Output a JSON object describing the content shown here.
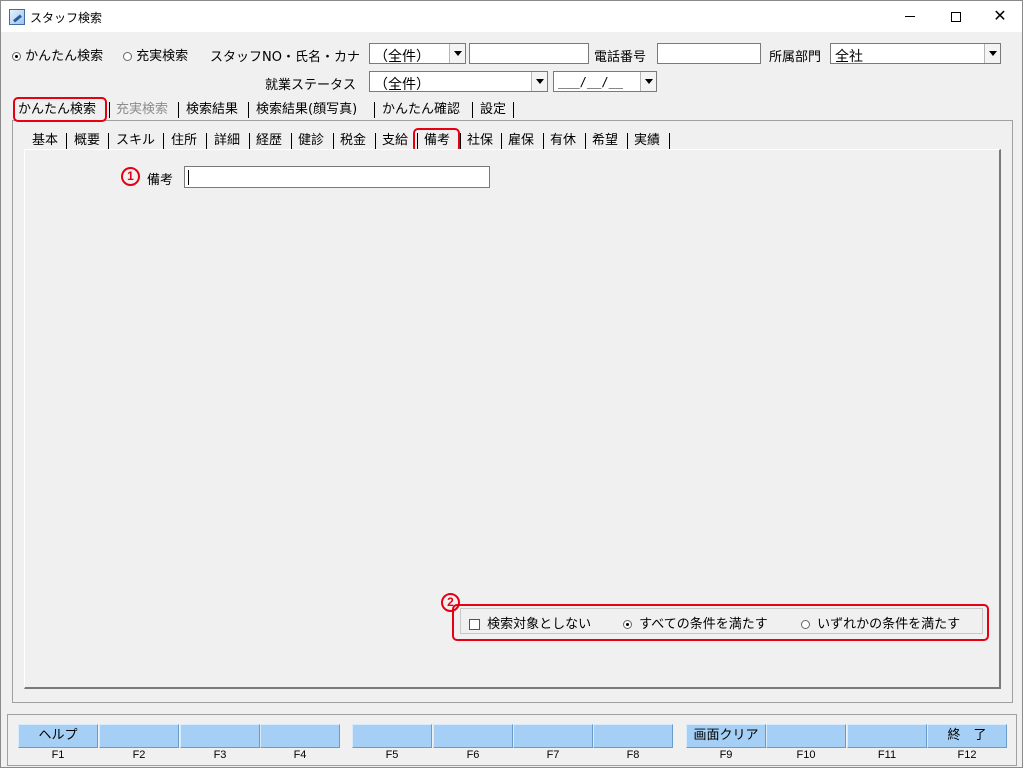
{
  "window": {
    "title": "スタッフ検索"
  },
  "search": {
    "mode_simple": "かんたん検索",
    "mode_full": "充実検索",
    "staff_label": "スタッフNO・氏名・カナ",
    "staff_combo_value": "（全件）",
    "staff_text_value": "",
    "phone_label": "電話番号",
    "phone_value": "",
    "dept_label": "所属部門",
    "dept_value": "全社",
    "status_label": "就業ステータス",
    "status_value": "（全件）",
    "date_value": "___/__/__"
  },
  "main_tabs": [
    "かんたん検索",
    "充実検索",
    "検索結果",
    "検索結果(顔写真)",
    "かんたん確認",
    "設定"
  ],
  "sub_tabs": [
    "基本",
    "概要",
    "スキル",
    "住所",
    "詳細",
    "経歴",
    "健診",
    "税金",
    "支給",
    "備考",
    "社保",
    "雇保",
    "有休",
    "希望",
    "実績"
  ],
  "annotations": {
    "one": "1",
    "two": "2"
  },
  "remarks": {
    "label": "備考",
    "value": ""
  },
  "conditions": {
    "exclude_label": "検索対象としない",
    "all_label": "すべての条件を満たす",
    "any_label": "いずれかの条件を満たす",
    "selected": "all"
  },
  "function_keys": [
    {
      "label": "ヘルプ",
      "key": "F1"
    },
    {
      "label": "",
      "key": "F2"
    },
    {
      "label": "",
      "key": "F3"
    },
    {
      "label": "",
      "key": "F4"
    },
    {
      "label": "",
      "key": "F5"
    },
    {
      "label": "",
      "key": "F6"
    },
    {
      "label": "",
      "key": "F7"
    },
    {
      "label": "",
      "key": "F8"
    },
    {
      "label": "画面クリア",
      "key": "F9"
    },
    {
      "label": "",
      "key": "F10"
    },
    {
      "label": "",
      "key": "F11"
    },
    {
      "label": "終　了",
      "key": "F12"
    }
  ],
  "colors": {
    "highlight": "#e60012",
    "fkey": "#a6cff5"
  }
}
